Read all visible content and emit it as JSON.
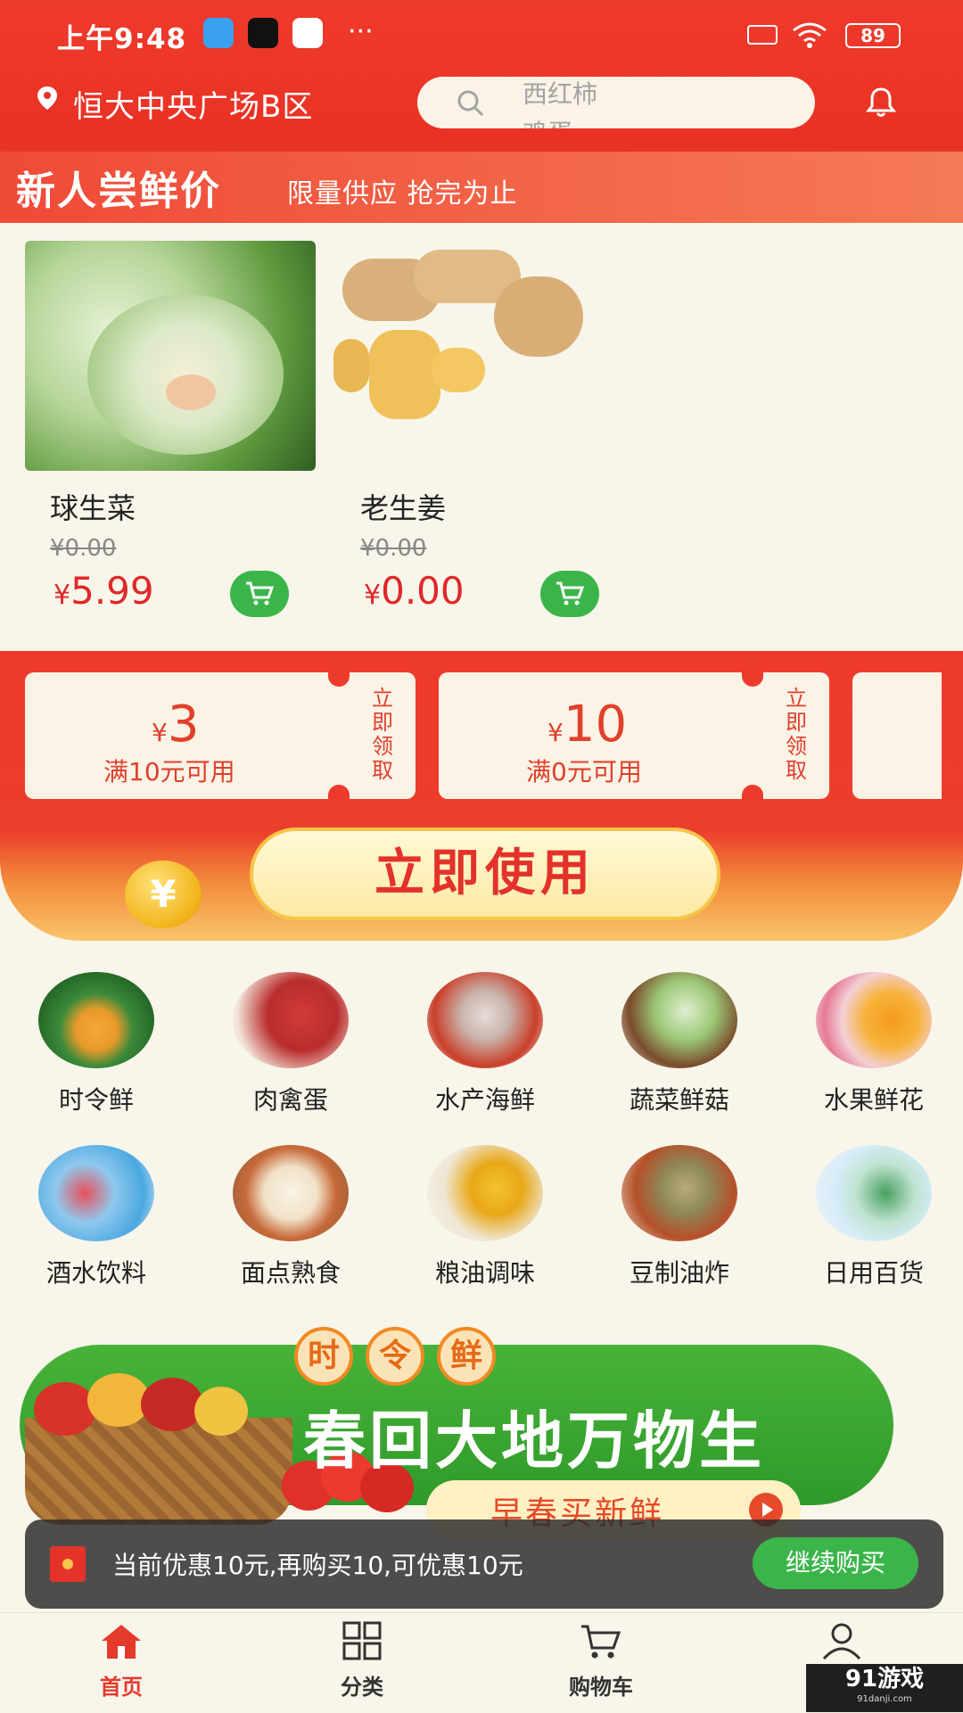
{
  "status_bar": {
    "time": "上午9:48",
    "battery": "89",
    "more": "···"
  },
  "header": {
    "location": "恒大中央广场B区",
    "search_placeholder": "西红柿",
    "search_placeholder_next": "鸡蛋",
    "new_user_title": "新人尝鲜价",
    "new_user_subtitle": "限量供应 抢完为止"
  },
  "products": [
    {
      "name": "球生菜",
      "original_price": "¥0.00",
      "currency": "¥",
      "price": "5.99"
    },
    {
      "name": "老生姜",
      "original_price": "¥0.00",
      "currency": "¥",
      "price": "0.00"
    }
  ],
  "coupons": [
    {
      "currency": "¥",
      "value": "3",
      "condition": "满10元可用",
      "claim": "立即领取"
    },
    {
      "currency": "¥",
      "value": "10",
      "condition": "满0元可用",
      "claim": "立即领取"
    }
  ],
  "use_now_label": "立即使用",
  "coin_symbol": "¥",
  "categories": [
    {
      "label": "时令鲜",
      "icon": "melon-icon"
    },
    {
      "label": "肉禽蛋",
      "icon": "meat-icon"
    },
    {
      "label": "水产海鲜",
      "icon": "fish-icon"
    },
    {
      "label": "蔬菜鲜菇",
      "icon": "vegetable-icon"
    },
    {
      "label": "水果鲜花",
      "icon": "fruit-flower-icon"
    },
    {
      "label": "酒水饮料",
      "icon": "drink-icon"
    },
    {
      "label": "面点熟食",
      "icon": "bun-icon"
    },
    {
      "label": "粮油调味",
      "icon": "oil-icon"
    },
    {
      "label": "豆制油炸",
      "icon": "tofu-icon"
    },
    {
      "label": "日用百货",
      "icon": "daily-goods-icon"
    }
  ],
  "banner": {
    "tags": [
      "时",
      "令",
      "鲜"
    ],
    "title": "春回大地万物生",
    "subtitle": "早春买新鲜"
  },
  "toast": {
    "message": "当前优惠10元,再购买10,可优惠10元",
    "button": "继续购买"
  },
  "tabs": [
    {
      "label": "首页",
      "active": true
    },
    {
      "label": "分类",
      "active": false
    },
    {
      "label": "购物车",
      "active": false
    },
    {
      "label": "我",
      "active": false
    }
  ],
  "watermark": {
    "text": "91游戏",
    "sub": "91danji.com"
  },
  "colors": {
    "primary_red": "#e93224",
    "accent_green": "#3bb54a",
    "background": "#f8f5ea"
  }
}
